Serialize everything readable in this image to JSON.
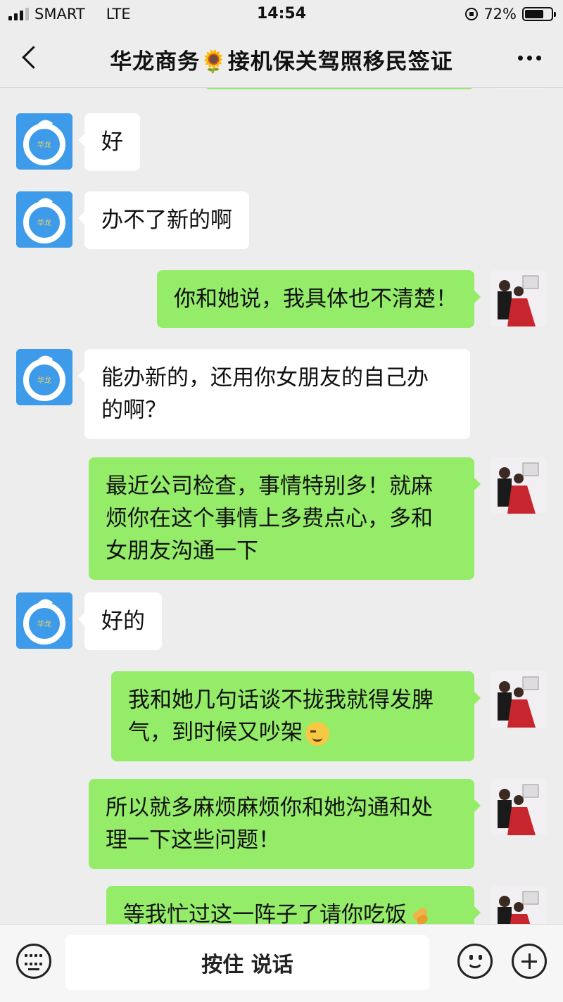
{
  "status_bar": {
    "carrier": "SMART",
    "network": "LTE",
    "time": "14:54",
    "battery": "72%"
  },
  "nav": {
    "title": "华龙商务🌻接机保关驾照移民签证"
  },
  "messages": [
    {
      "side": "left",
      "text": "好"
    },
    {
      "side": "left",
      "text": "办不了新的啊"
    },
    {
      "side": "right",
      "text": "你和她说，我具体也不清楚！"
    },
    {
      "side": "left",
      "text_lines": [
        "能办新的，还用你女朋友的自己办",
        "的啊？"
      ]
    },
    {
      "side": "right",
      "text_lines": [
        "最近公司检查，事情特别多！就麻",
        "烦你在这个事情上多费点心，多和",
        "女朋友沟通一下"
      ]
    },
    {
      "side": "left",
      "text": "好的"
    },
    {
      "side": "right",
      "text_lines": [
        "我和她几句话谈不拢我就得发脾",
        "气，到时候又吵架"
      ],
      "emoji": "unamused-face-icon"
    },
    {
      "side": "right",
      "text_lines": [
        "所以就多麻烦麻烦你和她沟通和处",
        "理一下这些问题！"
      ]
    },
    {
      "side": "right",
      "text": "等我忙过这一阵子了请你吃饭",
      "emoji": "pinching-hand-icon"
    }
  ],
  "input_bar": {
    "hold_to_talk": "按住 说话"
  },
  "colors": {
    "background": "#ededed",
    "sent_bubble": "#95ec69",
    "received_bubble": "#ffffff",
    "avatar_blue": "#3d9bea"
  }
}
